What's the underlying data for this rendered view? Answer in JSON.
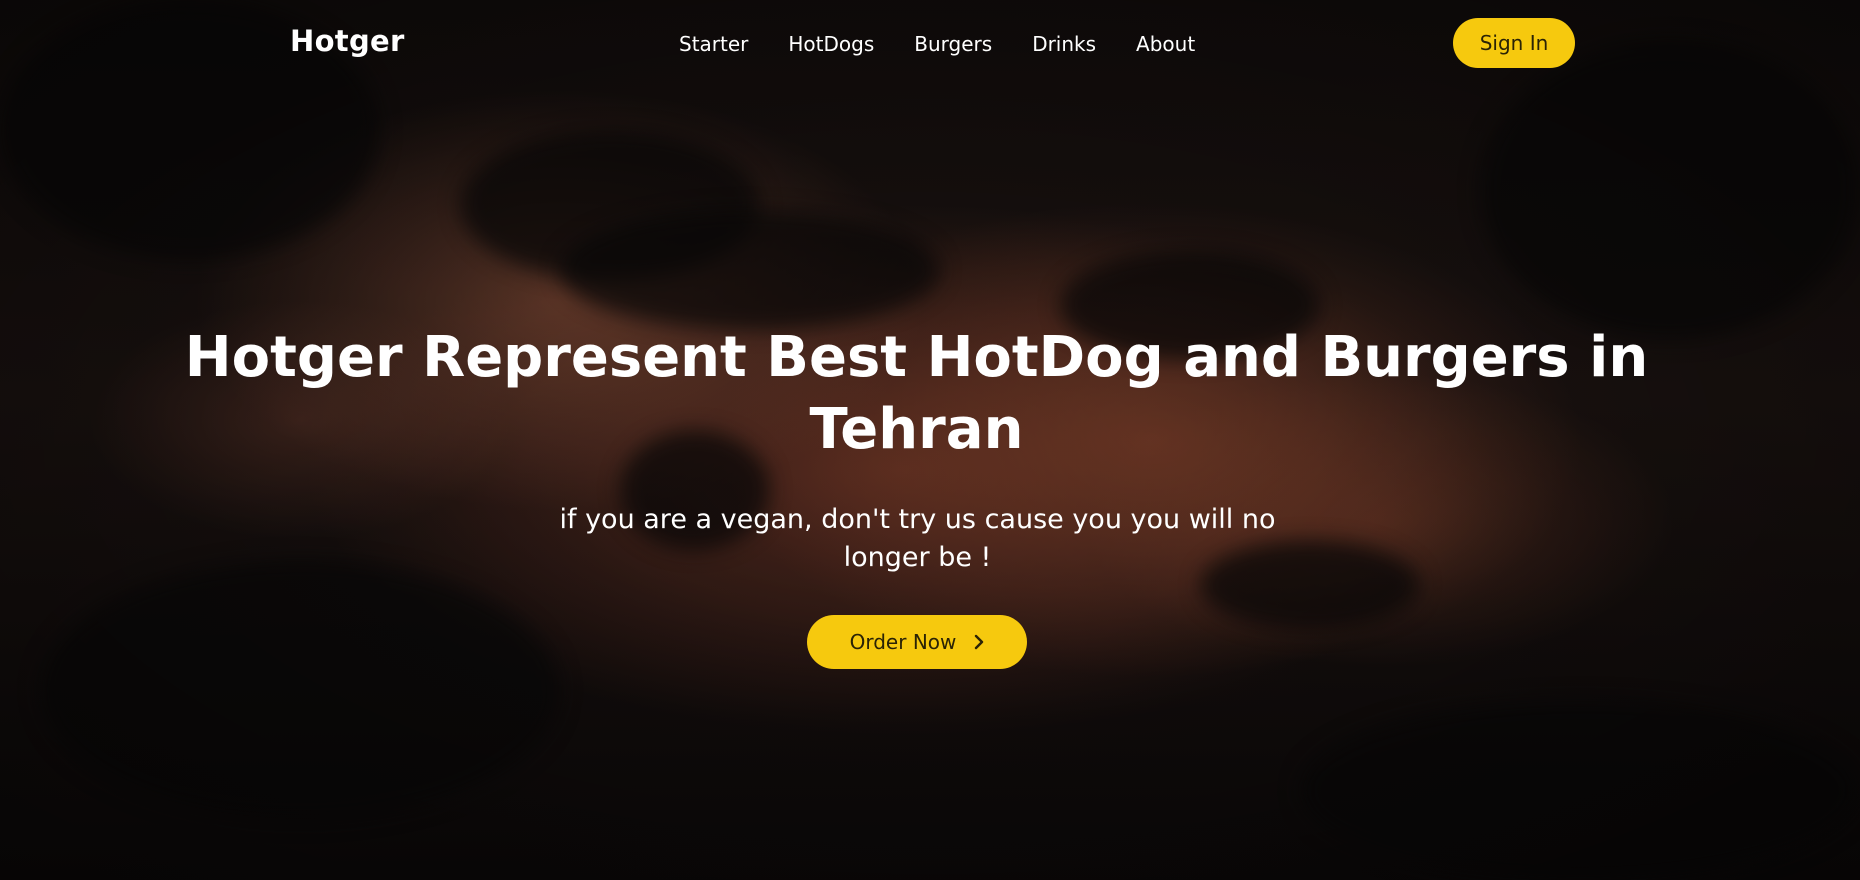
{
  "brand": {
    "logo": "Hotger"
  },
  "nav": {
    "items": [
      {
        "label": "Starter"
      },
      {
        "label": "HotDogs"
      },
      {
        "label": "Burgers"
      },
      {
        "label": "Drinks"
      },
      {
        "label": "About"
      }
    ],
    "signin_label": "Sign In"
  },
  "hero": {
    "title": "Hotger Represent Best HotDog and Burgers in Tehran",
    "subtitle": "if you are a vegan, don't try us cause you you will no longer be !",
    "cta_label": "Order Now",
    "cta_icon": "chevron-right-icon",
    "background": "grilled-burger-patty-photo"
  },
  "colors": {
    "accent": "#f6c90e",
    "text": "#ffffff",
    "button_text": "#2a2305"
  }
}
